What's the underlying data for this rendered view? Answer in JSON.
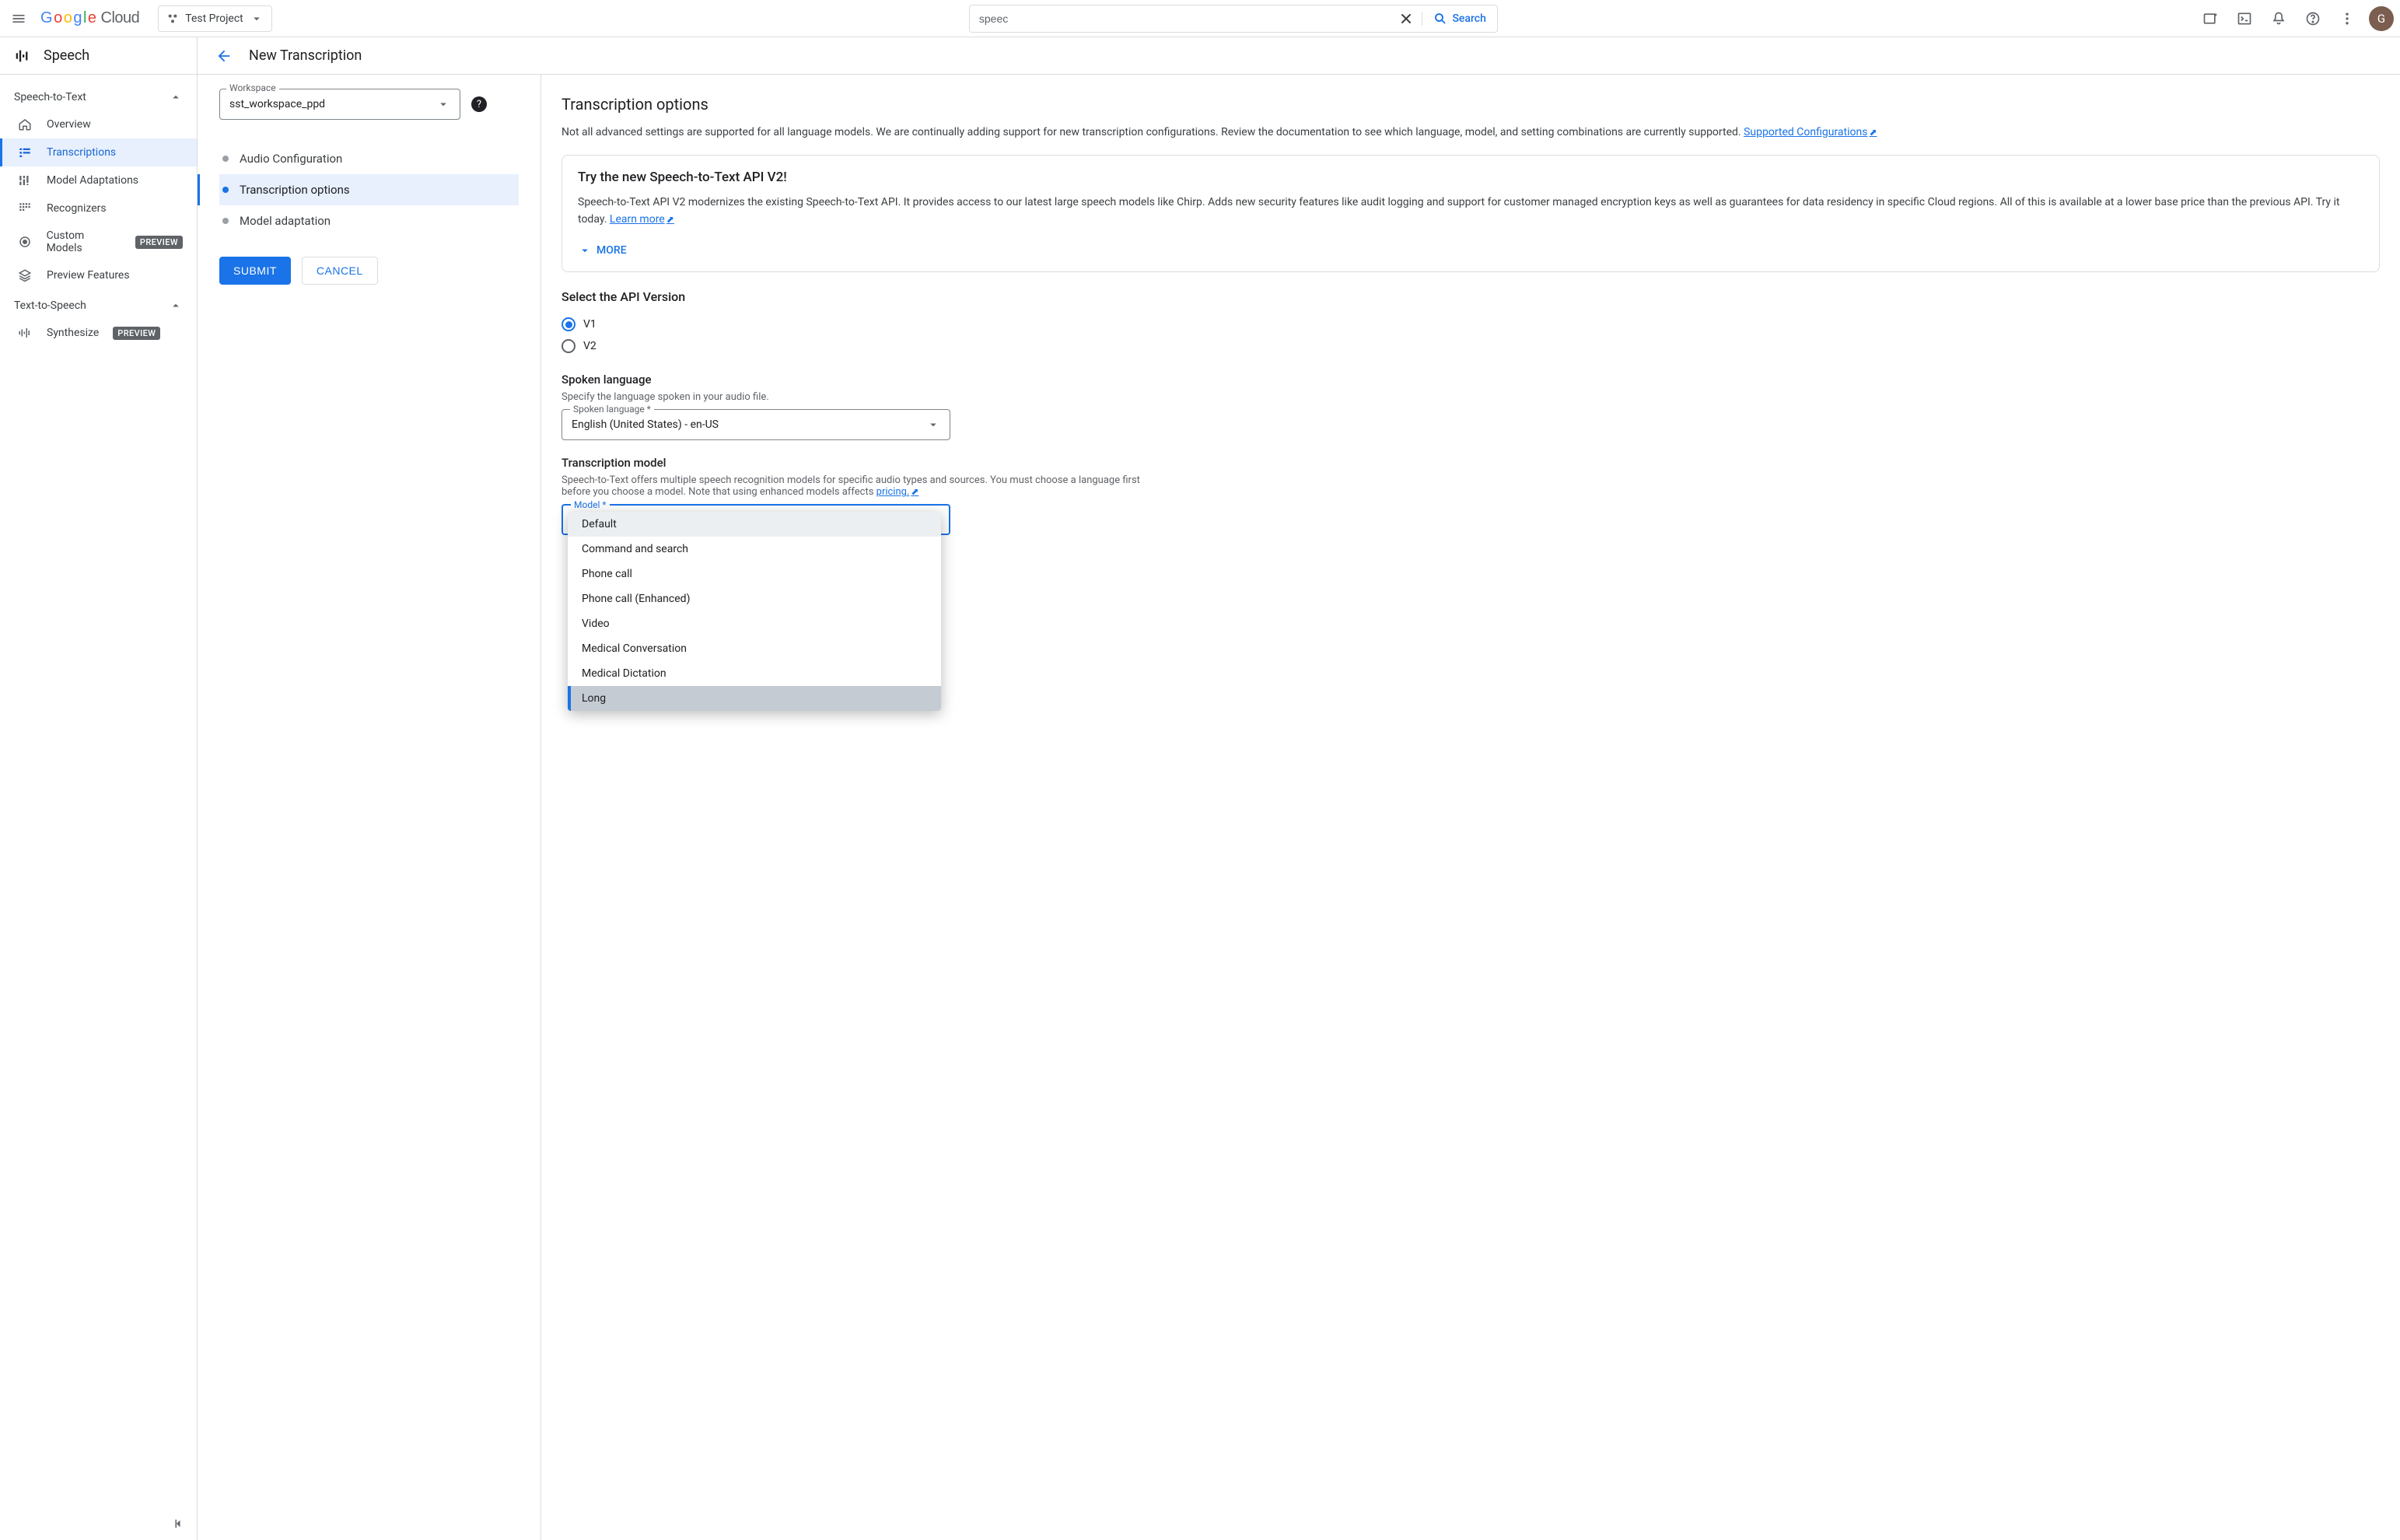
{
  "topbar": {
    "logo_cloud": "Cloud",
    "project_name": "Test Project",
    "search_value": "speec",
    "search_button": "Search"
  },
  "avatar_initial": "G",
  "product": {
    "title": "Speech",
    "page_title": "New Transcription"
  },
  "sidebar": {
    "sections": {
      "stt": {
        "label": "Speech-to-Text"
      },
      "tts": {
        "label": "Text-to-Speech"
      }
    },
    "items": {
      "overview": "Overview",
      "transcriptions": "Transcriptions",
      "model_adaptations": "Model Adaptations",
      "recognizers": "Recognizers",
      "custom_models": "Custom Models",
      "preview_features": "Preview Features",
      "synthesize": "Synthesize"
    },
    "badge_preview": "PREVIEW"
  },
  "stepper": {
    "workspace_label": "Workspace",
    "workspace_value": "sst_workspace_ppd",
    "steps": {
      "audio": "Audio Configuration",
      "options": "Transcription options",
      "adaptation": "Model adaptation"
    },
    "submit": "SUBMIT",
    "cancel": "CANCEL"
  },
  "content": {
    "heading": "Transcription options",
    "desc": "Not all advanced settings are supported for all language models. We are continually adding support for new transcription configurations. Review the documentation to see which language, model, and setting combinations are currently supported. ",
    "supported_link": "Supported Configurations",
    "promo": {
      "title": "Try the new Speech-to-Text API V2!",
      "body": "Speech-to-Text API V2 modernizes the existing Speech-to-Text API. It provides access to our latest large speech models like Chirp. Adds new security features like audit logging and support for customer managed encryption keys as well as guarantees for data residency in specific Cloud regions. All of this is available at a lower base price than the previous API. Try it today. ",
      "learn_more": "Learn more",
      "more": "MORE"
    },
    "api_version": {
      "title": "Select the API Version",
      "v1": "V1",
      "v2": "V2"
    },
    "spoken_language": {
      "title": "Spoken language",
      "desc": "Specify the language spoken in your audio file.",
      "field_label": "Spoken language *",
      "value": "English (United States) - en-US"
    },
    "model": {
      "title": "Transcription model",
      "desc_pre": "Speech-to-Text offers multiple speech recognition models for specific audio types and sources. You must choose a language first before you choose a model. Note that using enhanced models affects ",
      "pricing_link": "pricing.",
      "field_label": "Model *",
      "options": [
        "Default",
        "Command and search",
        "Phone call",
        "Phone call (Enhanced)",
        "Video",
        "Medical Conversation",
        "Medical Dictation",
        "Long"
      ],
      "selected_index": 7,
      "hover_index": 0
    }
  }
}
